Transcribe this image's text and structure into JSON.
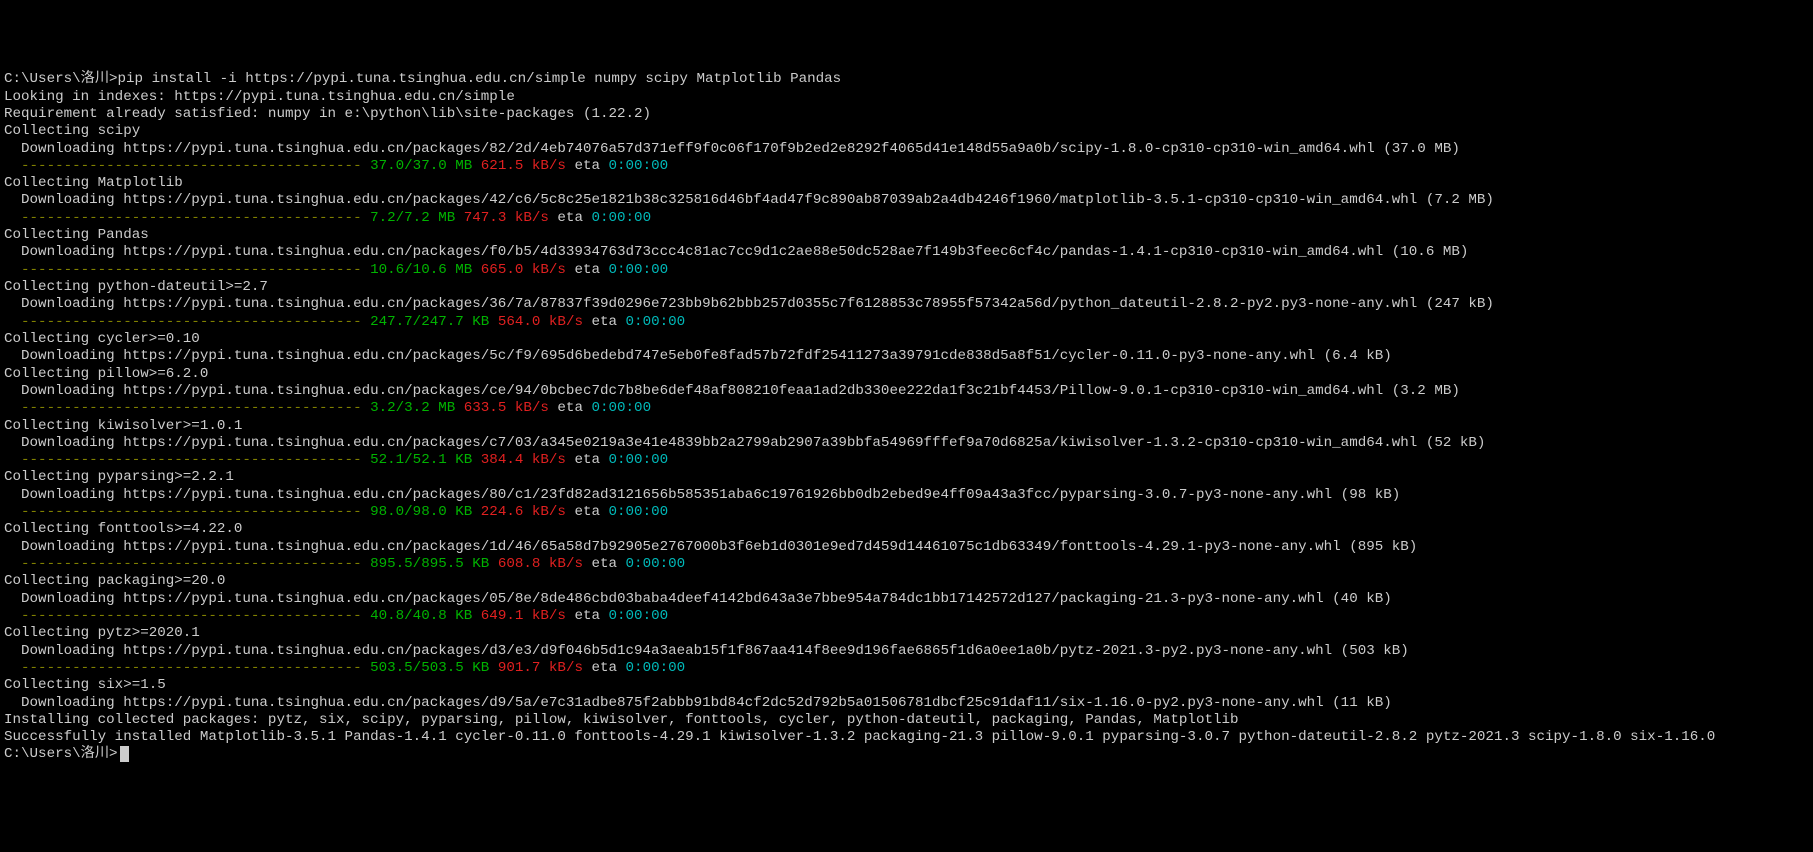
{
  "prompt_path": "C:\\Users\\洛川>",
  "command": "pip install -i https://pypi.tuna.tsinghua.edu.cn/simple numpy scipy Matplotlib Pandas",
  "looking": "Looking in indexes: https://pypi.tuna.tsinghua.edu.cn/simple",
  "already": "Requirement already satisfied: numpy in e:\\python\\lib\\site-packages (1.22.2)",
  "dashes": "  ---------------------------------------- ",
  "eta_label": " eta ",
  "eta_time": "0:00:00",
  "packages": [
    {
      "collect": "Collecting scipy",
      "download": "  Downloading https://pypi.tuna.tsinghua.edu.cn/packages/82/2d/4eb74076a57d371eff9f0c06f170f9b2ed2e8292f4065d41e148d55a9a0b/scipy-1.8.0-cp310-cp310-win_amd64.whl (37.0 MB)",
      "progress": "37.0/37.0 MB",
      "speed": "621.5 kB/s"
    },
    {
      "collect": "Collecting Matplotlib",
      "download": "  Downloading https://pypi.tuna.tsinghua.edu.cn/packages/42/c6/5c8c25e1821b38c325816d46bf4ad47f9c890ab87039ab2a4db4246f1960/matplotlib-3.5.1-cp310-cp310-win_amd64.whl (7.2 MB)",
      "progress": "7.2/7.2 MB",
      "speed": "747.3 kB/s"
    },
    {
      "collect": "Collecting Pandas",
      "download": "  Downloading https://pypi.tuna.tsinghua.edu.cn/packages/f0/b5/4d33934763d73ccc4c81ac7cc9d1c2ae88e50dc528ae7f149b3feec6cf4c/pandas-1.4.1-cp310-cp310-win_amd64.whl (10.6 MB)",
      "progress": "10.6/10.6 MB",
      "speed": "665.0 kB/s"
    },
    {
      "collect": "Collecting python-dateutil>=2.7",
      "download": "  Downloading https://pypi.tuna.tsinghua.edu.cn/packages/36/7a/87837f39d0296e723bb9b62bbb257d0355c7f6128853c78955f57342a56d/python_dateutil-2.8.2-py2.py3-none-any.whl (247 kB)",
      "progress": "247.7/247.7 KB",
      "speed": "564.0 kB/s"
    },
    {
      "collect": "Collecting cycler>=0.10",
      "download": "  Downloading https://pypi.tuna.tsinghua.edu.cn/packages/5c/f9/695d6bedebd747e5eb0fe8fad57b72fdf25411273a39791cde838d5a8f51/cycler-0.11.0-py3-none-any.whl (6.4 kB)",
      "progress": null,
      "speed": null
    },
    {
      "collect": "Collecting pillow>=6.2.0",
      "download": "  Downloading https://pypi.tuna.tsinghua.edu.cn/packages/ce/94/0bcbec7dc7b8be6def48af808210feaa1ad2db330ee222da1f3c21bf4453/Pillow-9.0.1-cp310-cp310-win_amd64.whl (3.2 MB)",
      "progress": "3.2/3.2 MB",
      "speed": "633.5 kB/s"
    },
    {
      "collect": "Collecting kiwisolver>=1.0.1",
      "download": "  Downloading https://pypi.tuna.tsinghua.edu.cn/packages/c7/03/a345e0219a3e41e4839bb2a2799ab2907a39bbfa54969fffef9a70d6825a/kiwisolver-1.3.2-cp310-cp310-win_amd64.whl (52 kB)",
      "progress": "52.1/52.1 KB",
      "speed": "384.4 kB/s"
    },
    {
      "collect": "Collecting pyparsing>=2.2.1",
      "download": "  Downloading https://pypi.tuna.tsinghua.edu.cn/packages/80/c1/23fd82ad3121656b585351aba6c19761926bb0db2ebed9e4ff09a43a3fcc/pyparsing-3.0.7-py3-none-any.whl (98 kB)",
      "progress": "98.0/98.0 KB",
      "speed": "224.6 kB/s"
    },
    {
      "collect": "Collecting fonttools>=4.22.0",
      "download": "  Downloading https://pypi.tuna.tsinghua.edu.cn/packages/1d/46/65a58d7b92905e2767000b3f6eb1d0301e9ed7d459d14461075c1db63349/fonttools-4.29.1-py3-none-any.whl (895 kB)",
      "progress": "895.5/895.5 KB",
      "speed": "608.8 kB/s"
    },
    {
      "collect": "Collecting packaging>=20.0",
      "download": "  Downloading https://pypi.tuna.tsinghua.edu.cn/packages/05/8e/8de486cbd03baba4deef4142bd643a3e7bbe954a784dc1bb17142572d127/packaging-21.3-py3-none-any.whl (40 kB)",
      "progress": "40.8/40.8 KB",
      "speed": "649.1 kB/s"
    },
    {
      "collect": "Collecting pytz>=2020.1",
      "download": "  Downloading https://pypi.tuna.tsinghua.edu.cn/packages/d3/e3/d9f046b5d1c94a3aeab15f1f867aa414f8ee9d196fae6865f1d6a0ee1a0b/pytz-2021.3-py2.py3-none-any.whl (503 kB)",
      "progress": "503.5/503.5 KB",
      "speed": "901.7 kB/s"
    },
    {
      "collect": "Collecting six>=1.5",
      "download": "  Downloading https://pypi.tuna.tsinghua.edu.cn/packages/d9/5a/e7c31adbe875f2abbb91bd84cf2dc52d792b5a01506781dbcf25c91daf11/six-1.16.0-py2.py3-none-any.whl (11 kB)",
      "progress": null,
      "speed": null
    }
  ],
  "installing": "Installing collected packages: pytz, six, scipy, pyparsing, pillow, kiwisolver, fonttools, cycler, python-dateutil, packaging, Pandas, Matplotlib",
  "success": "Successfully installed Matplotlib-3.5.1 Pandas-1.4.1 cycler-0.11.0 fonttools-4.29.1 kiwisolver-1.3.2 packaging-21.3 pillow-9.0.1 pyparsing-3.0.7 python-dateutil-2.8.2 pytz-2021.3 scipy-1.8.0 six-1.16.0"
}
